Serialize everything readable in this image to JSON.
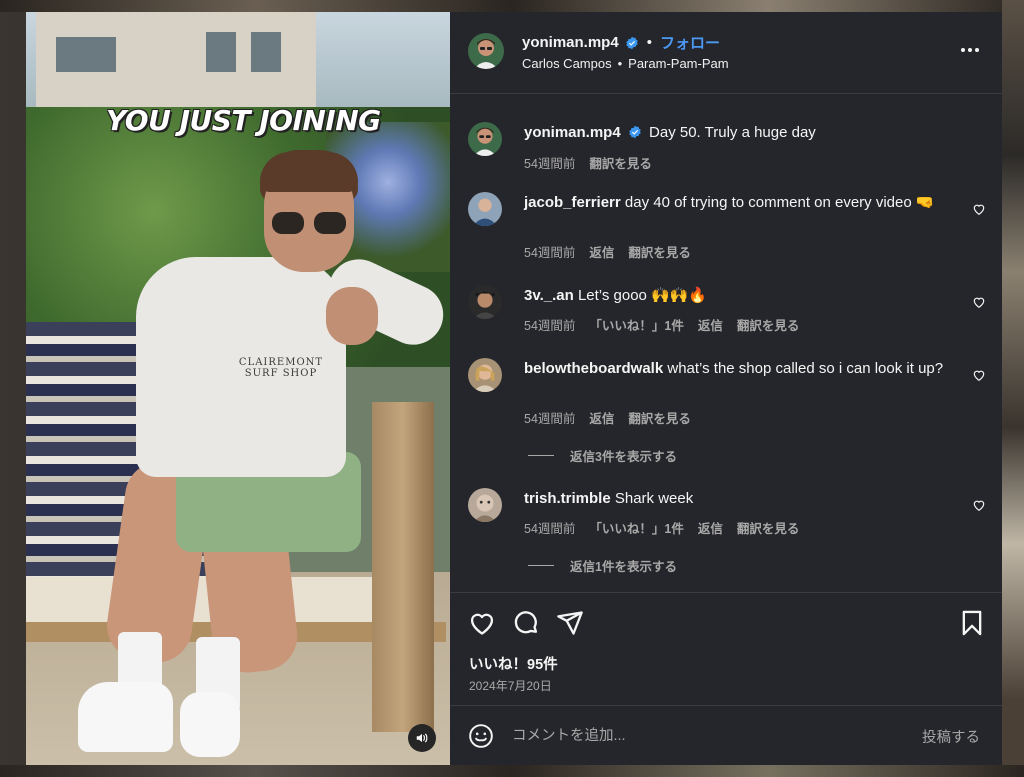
{
  "video": {
    "overlay_text": "YOU JUST JOINING",
    "shirt_print": "CLAIREMONT SURF SHOP",
    "mute_icon": "speaker-icon"
  },
  "header": {
    "username": "yoniman.mp4",
    "separator": "•",
    "follow_label": "フォロー",
    "audio_artist": "Carlos Campos",
    "audio_separator": "•",
    "audio_title": "Param-Pam-Pam",
    "more_icon": "more-horizontal-icon"
  },
  "caption": {
    "username": "yoniman.mp4",
    "text": "Day 50. Truly a huge day",
    "time": "54週間前",
    "translate": "翻訳を見る"
  },
  "comments": [
    {
      "username": "jacob_ferrierr",
      "text": "day 40 of trying to comment on every video 🤜",
      "time": "54週間前",
      "reply": "返信",
      "translate": "翻訳を見る",
      "likes": ""
    },
    {
      "username": "3v._.an",
      "text": "Let’s gooo 🙌🙌🔥",
      "time": "54週間前",
      "likes": "「いいね！」1件",
      "reply": "返信",
      "translate": "翻訳を見る"
    },
    {
      "username": "belowtheboardwalk",
      "text": "what’s the shop called so i can look it up?",
      "time": "54週間前",
      "reply": "返信",
      "translate": "翻訳を見る",
      "likes": "",
      "view_replies": "返信3件を表示する"
    },
    {
      "username": "trish.trimble",
      "text": "Shark week",
      "time": "54週間前",
      "likes": "「いいね！」1件",
      "reply": "返信",
      "translate": "翻訳を見る",
      "view_replies": "返信1件を表示する"
    }
  ],
  "actions": {
    "likes": "いいね！95件",
    "date": "2024年7月20日"
  },
  "compose": {
    "placeholder": "コメントを追加...",
    "post_label": "投稿する"
  },
  "colors": {
    "panel_bg": "#25262b",
    "accent_blue": "#4a9af5",
    "muted_text": "#a8a8a8"
  }
}
